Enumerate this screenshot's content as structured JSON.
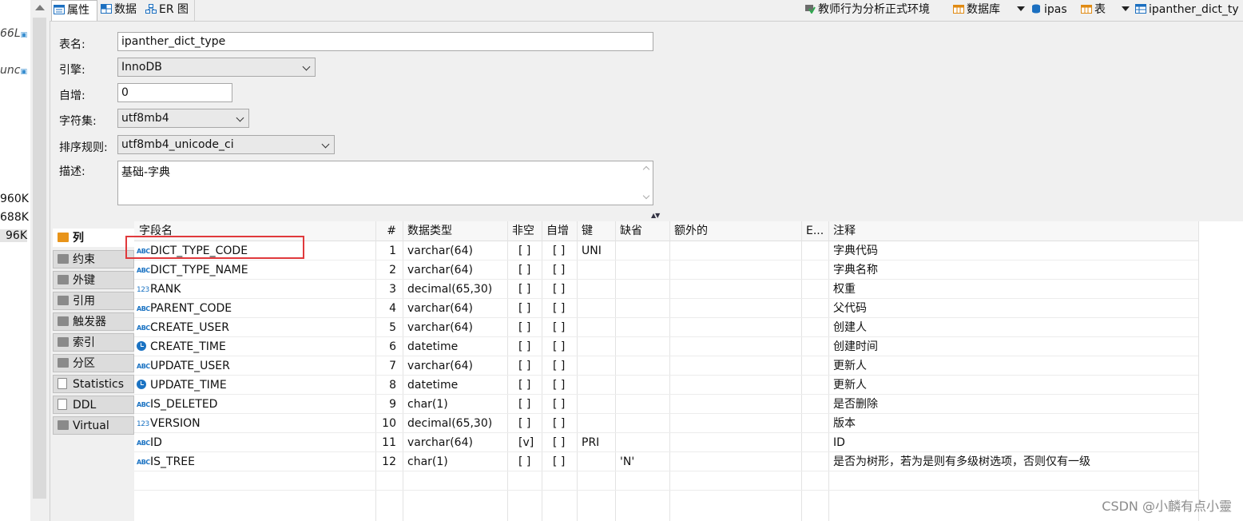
{
  "navigator": {
    "truncated_items": [
      "66L",
      "unc"
    ],
    "sizes": [
      "960K",
      "688K",
      "96K"
    ]
  },
  "top_tabs": [
    {
      "label": "属性",
      "icon": "properties-icon"
    },
    {
      "label": "数据",
      "icon": "data-grid-icon"
    },
    {
      "label": "ER 图",
      "icon": "er-diagram-icon"
    }
  ],
  "breadcrumb": {
    "connection": "教师行为分析正式环境",
    "database_type": "数据库",
    "schema": "ipas",
    "object_type": "表",
    "table": "ipanther_dict_ty"
  },
  "form": {
    "table_name_label": "表名:",
    "table_name": "ipanther_dict_type",
    "engine_label": "引擎:",
    "engine": "InnoDB",
    "auto_inc_label": "自增:",
    "auto_inc": "0",
    "charset_label": "字符集:",
    "charset": "utf8mb4",
    "collation_label": "排序规则:",
    "collation": "utf8mb4_unicode_ci",
    "desc_label": "描述:",
    "description": "基础-字典"
  },
  "side_tabs": [
    "列",
    "约束",
    "外键",
    "引用",
    "触发器",
    "索引",
    "分区",
    "Statistics",
    "DDL",
    "Virtual"
  ],
  "columns_header": [
    "字段名",
    "#",
    "数据类型",
    "非空",
    "自增",
    "键",
    "缺省",
    "额外的",
    "E...",
    "注释"
  ],
  "rows": [
    {
      "type_icon": "key-text",
      "name": "DICT_TYPE_CODE",
      "num": "1",
      "dtype": "varchar(64)",
      "notnull": "[ ]",
      "autoinc": "[ ]",
      "key": "UNI",
      "default": "",
      "comment": "字典代码"
    },
    {
      "type_icon": "text",
      "name": "DICT_TYPE_NAME",
      "num": "2",
      "dtype": "varchar(64)",
      "notnull": "[ ]",
      "autoinc": "[ ]",
      "key": "",
      "default": "",
      "comment": "字典名称"
    },
    {
      "type_icon": "number",
      "name": "RANK",
      "num": "3",
      "dtype": "decimal(65,30)",
      "notnull": "[ ]",
      "autoinc": "[ ]",
      "key": "",
      "default": "",
      "comment": "权重"
    },
    {
      "type_icon": "text",
      "name": "PARENT_CODE",
      "num": "4",
      "dtype": "varchar(64)",
      "notnull": "[ ]",
      "autoinc": "[ ]",
      "key": "",
      "default": "",
      "comment": "父代码"
    },
    {
      "type_icon": "text",
      "name": "CREATE_USER",
      "num": "5",
      "dtype": "varchar(64)",
      "notnull": "[ ]",
      "autoinc": "[ ]",
      "key": "",
      "default": "",
      "comment": "创建人"
    },
    {
      "type_icon": "clock",
      "name": "CREATE_TIME",
      "num": "6",
      "dtype": "datetime",
      "notnull": "[ ]",
      "autoinc": "[ ]",
      "key": "",
      "default": "",
      "comment": "创建时间"
    },
    {
      "type_icon": "text",
      "name": "UPDATE_USER",
      "num": "7",
      "dtype": "varchar(64)",
      "notnull": "[ ]",
      "autoinc": "[ ]",
      "key": "",
      "default": "",
      "comment": "更新人"
    },
    {
      "type_icon": "clock",
      "name": "UPDATE_TIME",
      "num": "8",
      "dtype": "datetime",
      "notnull": "[ ]",
      "autoinc": "[ ]",
      "key": "",
      "default": "",
      "comment": "更新人"
    },
    {
      "type_icon": "text",
      "name": "IS_DELETED",
      "num": "9",
      "dtype": "char(1)",
      "notnull": "[ ]",
      "autoinc": "[ ]",
      "key": "",
      "default": "",
      "comment": "是否删除"
    },
    {
      "type_icon": "number",
      "name": "VERSION",
      "num": "10",
      "dtype": "decimal(65,30)",
      "notnull": "[ ]",
      "autoinc": "[ ]",
      "key": "",
      "default": "",
      "comment": "版本"
    },
    {
      "type_icon": "key-text",
      "name": "ID",
      "num": "11",
      "dtype": "varchar(64)",
      "notnull": "[v]",
      "autoinc": "[ ]",
      "key": "PRI",
      "default": "",
      "comment": "ID"
    },
    {
      "type_icon": "text",
      "name": "IS_TREE",
      "num": "12",
      "dtype": "char(1)",
      "notnull": "[ ]",
      "autoinc": "[ ]",
      "key": "",
      "default": "'N'",
      "comment": "是否为树形，若为是则有多级树选项，否则仅有一级"
    }
  ],
  "watermark": "CSDN @小麟有点小靈"
}
